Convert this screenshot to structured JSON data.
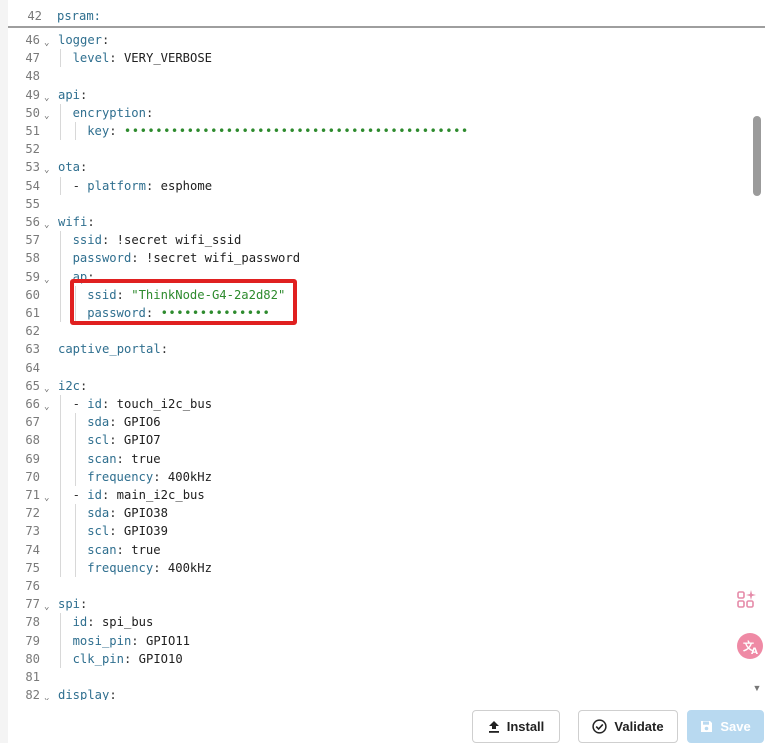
{
  "sticky_line": {
    "number": "42",
    "code": "psram:"
  },
  "lines": [
    {
      "n": "46",
      "fold": true,
      "indent": 0,
      "key": "logger",
      "sep": ":"
    },
    {
      "n": "47",
      "indent": 1,
      "key": "level",
      "sep": ": ",
      "value": "VERY_VERBOSE"
    },
    {
      "n": "48"
    },
    {
      "n": "49",
      "fold": true,
      "indent": 0,
      "key": "api",
      "sep": ":"
    },
    {
      "n": "50",
      "fold": true,
      "indent": 1,
      "key": "encryption",
      "sep": ":"
    },
    {
      "n": "51",
      "indent": 2,
      "key": "key",
      "sep": ": ",
      "masked": "••••••••••••••••••••••••••••••••••••••••••••"
    },
    {
      "n": "52"
    },
    {
      "n": "53",
      "fold": true,
      "indent": 0,
      "key": "ota",
      "sep": ":"
    },
    {
      "n": "54",
      "indent": 1,
      "dash": "- ",
      "key": "platform",
      "sep": ": ",
      "value": "esphome"
    },
    {
      "n": "55"
    },
    {
      "n": "56",
      "fold": true,
      "indent": 0,
      "key": "wifi",
      "sep": ":"
    },
    {
      "n": "57",
      "indent": 1,
      "key": "ssid",
      "sep": ": ",
      "value": "!secret wifi_ssid"
    },
    {
      "n": "58",
      "indent": 1,
      "key": "password",
      "sep": ": ",
      "value": "!secret wifi_password"
    },
    {
      "n": "59",
      "fold": true,
      "indent": 1,
      "key": "ap",
      "sep": ":"
    },
    {
      "n": "60",
      "indent": 2,
      "key": "ssid",
      "sep": ": ",
      "string": "\"ThinkNode-G4-2a2d82\""
    },
    {
      "n": "61",
      "indent": 2,
      "key": "password",
      "sep": ": ",
      "masked": "••••••••••••••"
    },
    {
      "n": "62"
    },
    {
      "n": "63",
      "indent": 0,
      "key": "captive_portal",
      "sep": ":"
    },
    {
      "n": "64"
    },
    {
      "n": "65",
      "fold": true,
      "indent": 0,
      "key": "i2c",
      "sep": ":"
    },
    {
      "n": "66",
      "fold": true,
      "indent": 1,
      "dash": "- ",
      "key": "id",
      "sep": ": ",
      "value": "touch_i2c_bus"
    },
    {
      "n": "67",
      "indent": 2,
      "key": "sda",
      "sep": ": ",
      "value": "GPIO6"
    },
    {
      "n": "68",
      "indent": 2,
      "key": "scl",
      "sep": ": ",
      "value": "GPIO7"
    },
    {
      "n": "69",
      "indent": 2,
      "key": "scan",
      "sep": ": ",
      "value": "true"
    },
    {
      "n": "70",
      "indent": 2,
      "key": "frequency",
      "sep": ": ",
      "value": "400kHz"
    },
    {
      "n": "71",
      "fold": true,
      "indent": 1,
      "dash": "- ",
      "key": "id",
      "sep": ": ",
      "value": "main_i2c_bus"
    },
    {
      "n": "72",
      "indent": 2,
      "key": "sda",
      "sep": ": ",
      "value": "GPIO38"
    },
    {
      "n": "73",
      "indent": 2,
      "key": "scl",
      "sep": ": ",
      "value": "GPIO39"
    },
    {
      "n": "74",
      "indent": 2,
      "key": "scan",
      "sep": ": ",
      "value": "true"
    },
    {
      "n": "75",
      "indent": 2,
      "key": "frequency",
      "sep": ": ",
      "value": "400kHz"
    },
    {
      "n": "76"
    },
    {
      "n": "77",
      "fold": true,
      "indent": 0,
      "key": "spi",
      "sep": ":"
    },
    {
      "n": "78",
      "indent": 1,
      "key": "id",
      "sep": ": ",
      "value": "spi_bus"
    },
    {
      "n": "79",
      "indent": 1,
      "key": "mosi_pin",
      "sep": ": ",
      "value": "GPIO11"
    },
    {
      "n": "80",
      "indent": 1,
      "key": "clk_pin",
      "sep": ": ",
      "value": "GPIO10"
    },
    {
      "n": "81"
    },
    {
      "n": "82",
      "fold": true,
      "indent": 0,
      "key": "display",
      "sep": ":"
    }
  ],
  "buttons": {
    "install": "Install",
    "validate": "Validate",
    "save": "Save"
  },
  "colors": {
    "key": "#2f6f8f",
    "string": "#2e8b2e",
    "highlight": "#e02020",
    "save_bg": "#b8d9f0"
  },
  "icons": [
    "fold-chevron-icon",
    "upload-icon",
    "check-circle-icon",
    "save-icon",
    "apps-sparkle-icon",
    "translate-icon"
  ]
}
